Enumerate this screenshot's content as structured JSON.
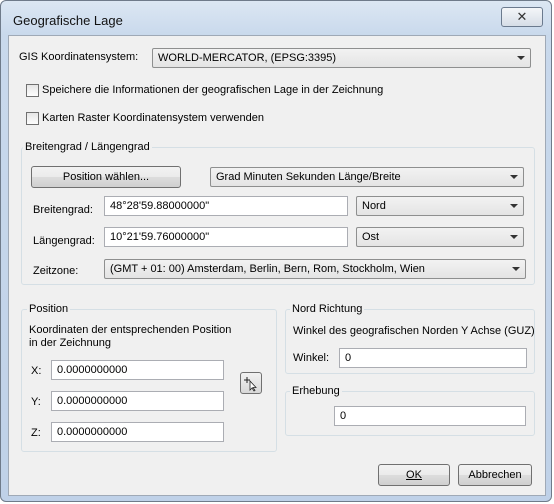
{
  "window": {
    "title": "Geografische Lage",
    "close_glyph": "✕"
  },
  "gis": {
    "label": "GIS Koordinatensystem:",
    "value": "WORLD-MERCATOR, (EPSG:3395)"
  },
  "checkboxes": {
    "save_in_drawing": {
      "label": "Speichere die Informationen der geografischen Lage in der Zeichnung",
      "checked": false
    },
    "use_raster": {
      "label": "Karten Raster Koordinatensystem verwenden",
      "checked": false
    }
  },
  "latlon": {
    "group_title": "Breitengrad / Längengrad",
    "choose_position_label": "Position wählen...",
    "format_value": "Grad Minuten Sekunden Länge/Breite",
    "latitude_label": "Breitengrad:",
    "latitude_value": "48°28'59.88000000\"",
    "latitude_dir": "Nord",
    "longitude_label": "Längengrad:",
    "longitude_value": "10°21'59.76000000\"",
    "longitude_dir": "Ost",
    "timezone_label": "Zeitzone:",
    "timezone_value": "(GMT + 01: 00) Amsterdam, Berlin, Bern, Rom, Stockholm, Wien"
  },
  "position": {
    "group_title": "Position",
    "description": "Koordinaten der entsprechenden Position in der Zeichnung",
    "x_label": "X:",
    "x_value": "0.0000000000",
    "y_label": "Y:",
    "y_value": "0.0000000000",
    "z_label": "Z:",
    "z_value": "0.0000000000"
  },
  "north": {
    "group_title": "Nord Richtung",
    "description": "Winkel des geografischen Norden Y Achse (GUZ)",
    "angle_label": "Winkel:",
    "angle_value": "0"
  },
  "elevation": {
    "group_title": "Erhebung",
    "value": "0"
  },
  "buttons": {
    "ok_label": "OK",
    "cancel_label": "Abbrechen"
  },
  "icons": {
    "close": "close-icon",
    "dropdown": "chevron-down-icon",
    "pick_point": "pick-point-icon"
  }
}
